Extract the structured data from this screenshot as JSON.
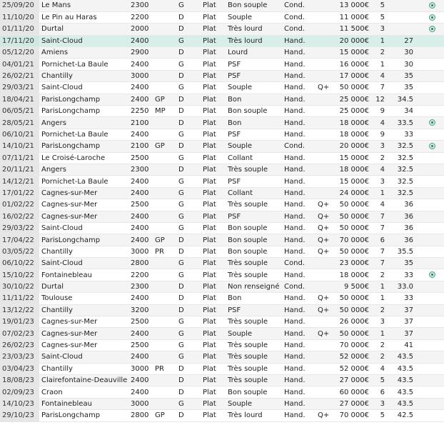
{
  "races": [
    {
      "date": "25/09/20",
      "venue": "Le Mans",
      "distance": "2300",
      "group": "",
      "corde": "G",
      "type": "Plat",
      "going": "Bon souple",
      "cond": "Cond.",
      "extra": "",
      "prize": "13 000€",
      "place": "5",
      "odds": "",
      "icon": true
    },
    {
      "date": "11/10/20",
      "venue": "Le Pin au Haras",
      "distance": "2200",
      "group": "",
      "corde": "D",
      "type": "Plat",
      "going": "Souple",
      "cond": "Cond.",
      "extra": "",
      "prize": "11 000€",
      "place": "5",
      "odds": "",
      "icon": true
    },
    {
      "date": "01/11/20",
      "venue": "Durtal",
      "distance": "2000",
      "group": "",
      "corde": "D",
      "type": "Plat",
      "going": "Très lourd",
      "cond": "Cond.",
      "extra": "",
      "prize": "11 500€",
      "place": "3",
      "odds": "",
      "icon": true
    },
    {
      "date": "17/11/20",
      "venue": "Saint-Cloud",
      "distance": "2400",
      "group": "",
      "corde": "G",
      "type": "Plat",
      "going": "Très lourd",
      "cond": "Hand.",
      "extra": "",
      "prize": "20 000€",
      "place": "1",
      "odds": "27",
      "icon": false,
      "highlight": true
    },
    {
      "date": "05/12/20",
      "venue": "Amiens",
      "distance": "2900",
      "group": "",
      "corde": "D",
      "type": "Plat",
      "going": "Lourd",
      "cond": "Hand.",
      "extra": "",
      "prize": "15 000€",
      "place": "2",
      "odds": "30",
      "icon": false
    },
    {
      "date": "04/01/21",
      "venue": "Pornichet-La Baule",
      "distance": "2400",
      "group": "",
      "corde": "G",
      "type": "Plat",
      "going": "PSF",
      "cond": "Hand.",
      "extra": "",
      "prize": "16 000€",
      "place": "1",
      "odds": "30",
      "icon": false
    },
    {
      "date": "26/02/21",
      "venue": "Chantilly",
      "distance": "3000",
      "group": "",
      "corde": "D",
      "type": "Plat",
      "going": "PSF",
      "cond": "Hand.",
      "extra": "",
      "prize": "17 000€",
      "place": "4",
      "odds": "35",
      "icon": false
    },
    {
      "date": "29/03/21",
      "venue": "Saint-Cloud",
      "distance": "2400",
      "group": "",
      "corde": "G",
      "type": "Plat",
      "going": "Souple",
      "cond": "Hand.",
      "extra": "Q+",
      "prize": "50 000€",
      "place": "7",
      "odds": "35",
      "icon": false
    },
    {
      "date": "18/04/21",
      "venue": "ParisLongchamp",
      "distance": "2400",
      "group": "GP",
      "corde": "D",
      "type": "Plat",
      "going": "Bon",
      "cond": "Hand.",
      "extra": "",
      "prize": "25 000€",
      "place": "12",
      "odds": "34.5",
      "icon": false
    },
    {
      "date": "06/05/21",
      "venue": "ParisLongchamp",
      "distance": "2250",
      "group": "MP",
      "corde": "D",
      "type": "Plat",
      "going": "Bon souple",
      "cond": "Hand.",
      "extra": "",
      "prize": "25 000€",
      "place": "9",
      "odds": "34",
      "icon": false
    },
    {
      "date": "28/05/21",
      "venue": "Angers",
      "distance": "2100",
      "group": "",
      "corde": "D",
      "type": "Plat",
      "going": "Bon",
      "cond": "Hand.",
      "extra": "",
      "prize": "18 000€",
      "place": "4",
      "odds": "33.5",
      "icon": true
    },
    {
      "date": "06/10/21",
      "venue": "Pornichet-La Baule",
      "distance": "2400",
      "group": "",
      "corde": "G",
      "type": "Plat",
      "going": "PSF",
      "cond": "Hand.",
      "extra": "",
      "prize": "18 000€",
      "place": "9",
      "odds": "33",
      "icon": false
    },
    {
      "date": "14/10/21",
      "venue": "ParisLongchamp",
      "distance": "2100",
      "group": "GP",
      "corde": "D",
      "type": "Plat",
      "going": "Souple",
      "cond": "Cond.",
      "extra": "",
      "prize": "20 000€",
      "place": "3",
      "odds": "32.5",
      "icon": true
    },
    {
      "date": "07/11/21",
      "venue": "Le Croisé-Laroche",
      "distance": "2500",
      "group": "",
      "corde": "G",
      "type": "Plat",
      "going": "Collant",
      "cond": "Hand.",
      "extra": "",
      "prize": "15 000€",
      "place": "2",
      "odds": "32.5",
      "icon": false
    },
    {
      "date": "20/11/21",
      "venue": "Angers",
      "distance": "2300",
      "group": "",
      "corde": "D",
      "type": "Plat",
      "going": "Très souple",
      "cond": "Hand.",
      "extra": "",
      "prize": "18 000€",
      "place": "4",
      "odds": "32.5",
      "icon": false
    },
    {
      "date": "14/12/21",
      "venue": "Pornichet-La Baule",
      "distance": "2400",
      "group": "",
      "corde": "G",
      "type": "Plat",
      "going": "PSF",
      "cond": "Hand.",
      "extra": "",
      "prize": "15 000€",
      "place": "3",
      "odds": "32.5",
      "icon": false
    },
    {
      "date": "17/01/22",
      "venue": "Cagnes-sur-Mer",
      "distance": "2400",
      "group": "",
      "corde": "G",
      "type": "Plat",
      "going": "Collant",
      "cond": "Hand.",
      "extra": "",
      "prize": "24 000€",
      "place": "1",
      "odds": "32.5",
      "icon": false
    },
    {
      "date": "01/02/22",
      "venue": "Cagnes-sur-Mer",
      "distance": "2500",
      "group": "",
      "corde": "G",
      "type": "Plat",
      "going": "Très souple",
      "cond": "Hand.",
      "extra": "Q+",
      "prize": "50 000€",
      "place": "4",
      "odds": "36",
      "icon": false
    },
    {
      "date": "16/02/22",
      "venue": "Cagnes-sur-Mer",
      "distance": "2400",
      "group": "",
      "corde": "G",
      "type": "Plat",
      "going": "PSF",
      "cond": "Hand.",
      "extra": "Q+",
      "prize": "50 000€",
      "place": "7",
      "odds": "36",
      "icon": false
    },
    {
      "date": "29/03/22",
      "venue": "Saint-Cloud",
      "distance": "2400",
      "group": "",
      "corde": "G",
      "type": "Plat",
      "going": "Bon souple",
      "cond": "Hand.",
      "extra": "Q+",
      "prize": "50 000€",
      "place": "7",
      "odds": "36",
      "icon": false
    },
    {
      "date": "17/04/22",
      "venue": "ParisLongchamp",
      "distance": "2400",
      "group": "GP",
      "corde": "D",
      "type": "Plat",
      "going": "Bon souple",
      "cond": "Hand.",
      "extra": "Q+",
      "prize": "70 000€",
      "place": "6",
      "odds": "36",
      "icon": false
    },
    {
      "date": "03/05/22",
      "venue": "Chantilly",
      "distance": "3000",
      "group": "PR",
      "corde": "D",
      "type": "Plat",
      "going": "Bon souple",
      "cond": "Hand.",
      "extra": "Q+",
      "prize": "50 000€",
      "place": "7",
      "odds": "35.5",
      "icon": false
    },
    {
      "date": "06/10/22",
      "venue": "Saint-Cloud",
      "distance": "2800",
      "group": "",
      "corde": "G",
      "type": "Plat",
      "going": "Très souple",
      "cond": "Cond.",
      "extra": "",
      "prize": "23 000€",
      "place": "7",
      "odds": "35",
      "icon": false
    },
    {
      "date": "15/10/22",
      "venue": "Fontainebleau",
      "distance": "2200",
      "group": "",
      "corde": "G",
      "type": "Plat",
      "going": "Très souple",
      "cond": "Hand.",
      "extra": "",
      "prize": "18 000€",
      "place": "2",
      "odds": "33",
      "icon": true
    },
    {
      "date": "30/10/22",
      "venue": "Durtal",
      "distance": "2300",
      "group": "",
      "corde": "D",
      "type": "Plat",
      "going": "Non renseigné",
      "cond": "Cond.",
      "extra": "",
      "prize": "9 500€",
      "place": "1",
      "odds": "33.0",
      "icon": false
    },
    {
      "date": "11/11/22",
      "venue": "Toulouse",
      "distance": "2400",
      "group": "",
      "corde": "D",
      "type": "Plat",
      "going": "Bon",
      "cond": "Hand.",
      "extra": "Q+",
      "prize": "50 000€",
      "place": "1",
      "odds": "33",
      "icon": false
    },
    {
      "date": "13/12/22",
      "venue": "Chantilly",
      "distance": "3200",
      "group": "",
      "corde": "D",
      "type": "Plat",
      "going": "PSF",
      "cond": "Hand.",
      "extra": "Q+",
      "prize": "50 000€",
      "place": "2",
      "odds": "37",
      "icon": false
    },
    {
      "date": "19/01/23",
      "venue": "Cagnes-sur-Mer",
      "distance": "2500",
      "group": "",
      "corde": "G",
      "type": "Plat",
      "going": "Très souple",
      "cond": "Hand.",
      "extra": "",
      "prize": "26 000€",
      "place": "3",
      "odds": "37",
      "icon": false
    },
    {
      "date": "07/02/23",
      "venue": "Cagnes-sur-Mer",
      "distance": "2400",
      "group": "",
      "corde": "G",
      "type": "Plat",
      "going": "Souple",
      "cond": "Hand.",
      "extra": "Q+",
      "prize": "50 000€",
      "place": "1",
      "odds": "37",
      "icon": false
    },
    {
      "date": "26/02/23",
      "venue": "Cagnes-sur-Mer",
      "distance": "2500",
      "group": "",
      "corde": "G",
      "type": "Plat",
      "going": "Très souple",
      "cond": "Hand.",
      "extra": "",
      "prize": "70 000€",
      "place": "2",
      "odds": "41",
      "icon": false
    },
    {
      "date": "23/03/23",
      "venue": "Saint-Cloud",
      "distance": "2400",
      "group": "",
      "corde": "G",
      "type": "Plat",
      "going": "Très souple",
      "cond": "Hand.",
      "extra": "",
      "prize": "52 000€",
      "place": "2",
      "odds": "43.5",
      "icon": false
    },
    {
      "date": "03/04/23",
      "venue": "Chantilly",
      "distance": "3000",
      "group": "PR",
      "corde": "D",
      "type": "Plat",
      "going": "Très souple",
      "cond": "Hand.",
      "extra": "",
      "prize": "52 000€",
      "place": "4",
      "odds": "43.5",
      "icon": false
    },
    {
      "date": "18/08/23",
      "venue": "Clairefontaine-Deauville",
      "distance": "2400",
      "group": "",
      "corde": "D",
      "type": "Plat",
      "going": "Très souple",
      "cond": "Hand.",
      "extra": "",
      "prize": "27 000€",
      "place": "5",
      "odds": "43.5",
      "icon": false
    },
    {
      "date": "02/09/23",
      "venue": "Craon",
      "distance": "2400",
      "group": "",
      "corde": "D",
      "type": "Plat",
      "going": "Bon souple",
      "cond": "Hand.",
      "extra": "",
      "prize": "60 000€",
      "place": "6",
      "odds": "43.5",
      "icon": false
    },
    {
      "date": "14/10/23",
      "venue": "Fontainebleau",
      "distance": "3000",
      "group": "",
      "corde": "G",
      "type": "Plat",
      "going": "Souple",
      "cond": "Hand.",
      "extra": "",
      "prize": "27 000€",
      "place": "3",
      "odds": "43.5",
      "icon": false
    },
    {
      "date": "29/10/23",
      "venue": "ParisLongchamp",
      "distance": "2800",
      "group": "GP",
      "corde": "D",
      "type": "Plat",
      "going": "Très lourd",
      "cond": "Hand.",
      "extra": "Q+",
      "prize": "70 000€",
      "place": "5",
      "odds": "42.5",
      "icon": false
    }
  ]
}
